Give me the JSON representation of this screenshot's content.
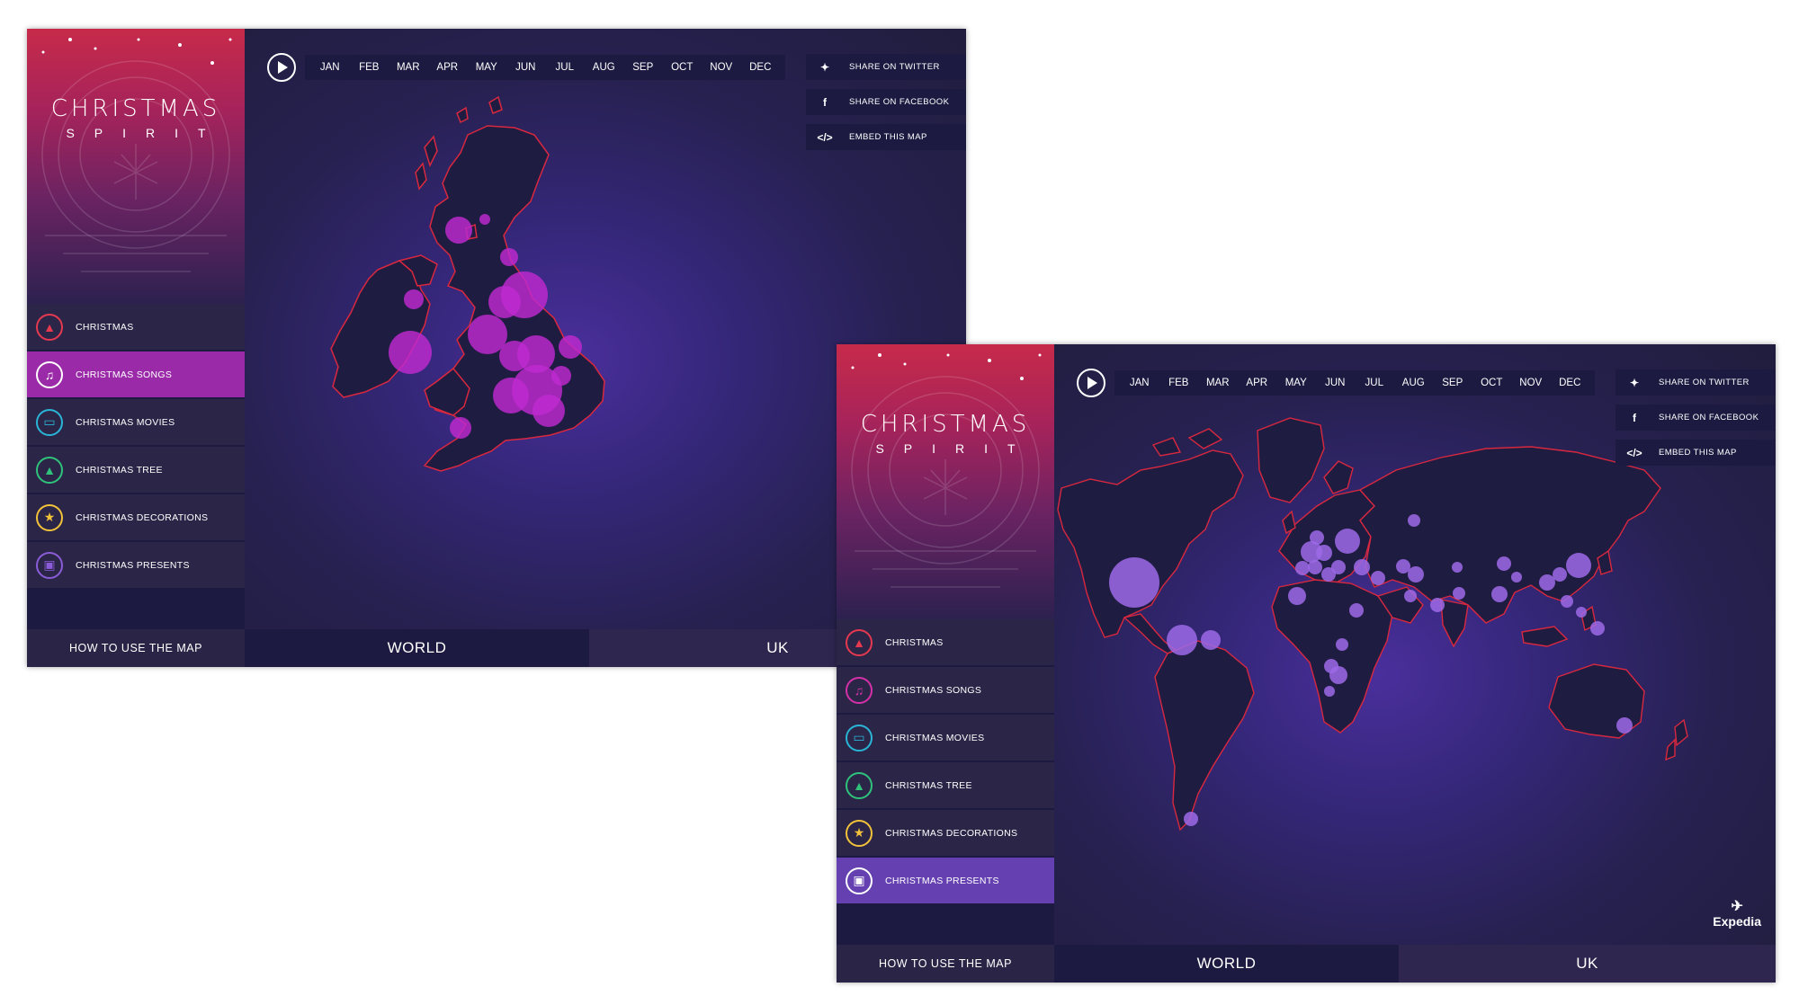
{
  "logo": {
    "title": "CHRISTMAS",
    "subtitle": "SPIRIT"
  },
  "categories": [
    {
      "label": "CHRISTMAS",
      "icon": "bell-icon",
      "color": "#e53950"
    },
    {
      "label": "CHRISTMAS SONGS",
      "icon": "music-note-icon",
      "color": "#d431a8"
    },
    {
      "label": "CHRISTMAS MOVIES",
      "icon": "tv-icon",
      "color": "#2ab5d6"
    },
    {
      "label": "CHRISTMAS TREE",
      "icon": "tree-icon",
      "color": "#2ec27a"
    },
    {
      "label": "CHRISTMAS DECORATIONS",
      "icon": "star-icon",
      "color": "#f2c23a"
    },
    {
      "label": "CHRISTMAS PRESENTS",
      "icon": "gift-icon",
      "color": "#8a5cd8"
    }
  ],
  "months": [
    "JAN",
    "FEB",
    "MAR",
    "APR",
    "MAY",
    "JUN",
    "JUL",
    "AUG",
    "SEP",
    "OCT",
    "NOV",
    "DEC"
  ],
  "share": [
    {
      "label": "SHARE ON TWITTER",
      "icon": "twitter-icon"
    },
    {
      "label": "SHARE ON FACEBOOK",
      "icon": "facebook-icon"
    },
    {
      "label": "EMBED THIS MAP",
      "icon": "code-icon"
    }
  ],
  "howto_label": "HOW TO USE THE MAP",
  "tabs": {
    "world": "WORLD",
    "uk": "UK"
  },
  "brand": {
    "name": "Expedia"
  },
  "panels": {
    "uk": {
      "active_category": "CHRISTMAS SONGS",
      "bubble_color": "#c02ad0"
    },
    "world": {
      "active_category": "CHRISTMAS PRESENTS",
      "bubble_color": "#9e6ae8"
    }
  },
  "colors": {
    "background": "#23203f",
    "sidebar": "#1c1a40",
    "coastline": "#d8283f",
    "land": "#1f1c42"
  }
}
